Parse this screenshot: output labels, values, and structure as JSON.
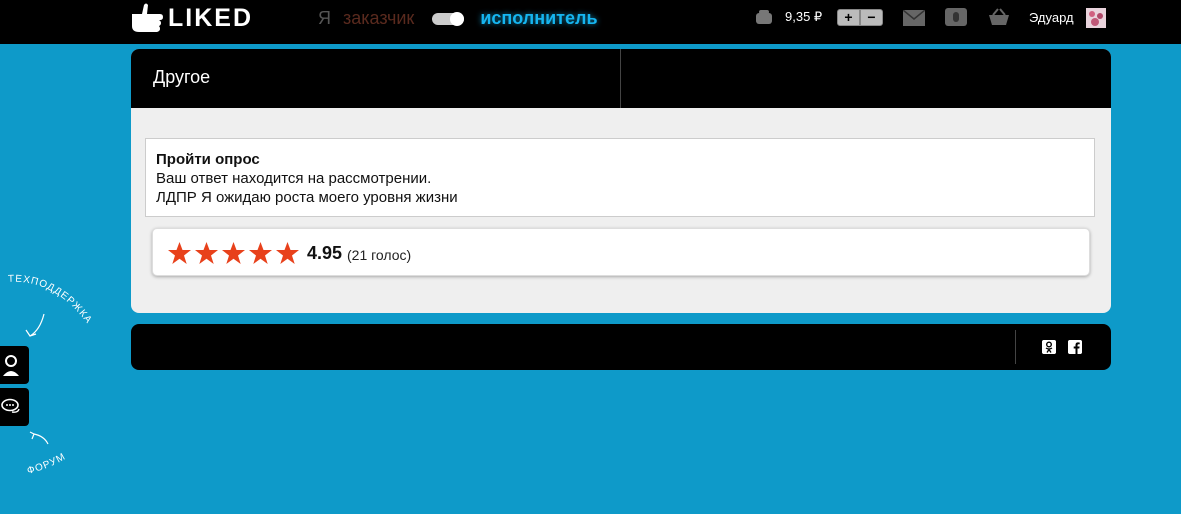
{
  "header": {
    "logo_text": "LIKED",
    "role_prefix": "Я",
    "role_customer": "заказчик",
    "role_performer": "исполнитель",
    "balance": "9,35 ₽",
    "plus_label": "+",
    "minus_label": "−",
    "username": "Эдуард"
  },
  "card": {
    "title": "Другое",
    "survey": {
      "title": "Пройти опрос",
      "status": "Ваш ответ находится на рассмотрении.",
      "answer": "ЛДПР Я ожидаю роста моего уровня жизни"
    },
    "rating": {
      "stars": 5,
      "value": "4.95",
      "votes": "(21 голос)"
    }
  },
  "side": {
    "support_label": "ТЕХПОДДЕРЖКА",
    "forum_label": "ФОРУМ"
  },
  "colors": {
    "background": "#0e9ac9",
    "star": "#e8411b",
    "performer": "#16b5f0"
  }
}
